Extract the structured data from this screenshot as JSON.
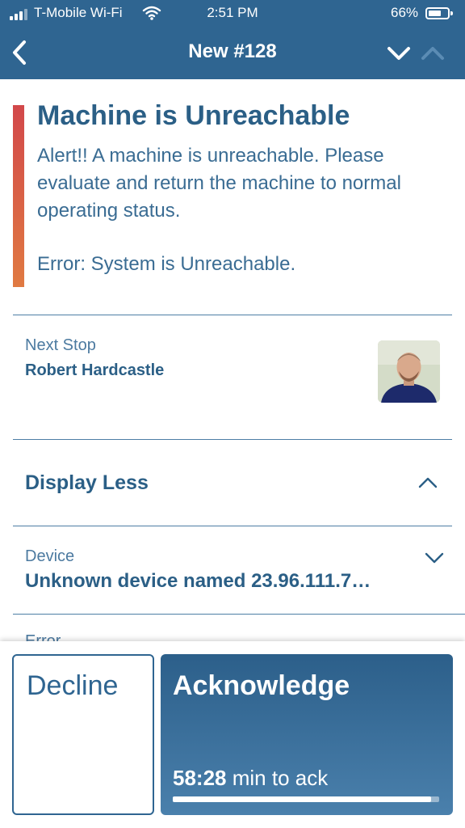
{
  "status_bar": {
    "carrier": "T-Mobile Wi-Fi",
    "time": "2:51 PM",
    "battery_percent": "66%",
    "battery_level": 0.66,
    "wifi_icon": "wifi-icon",
    "signal_icon": "signal-bars-icon"
  },
  "nav": {
    "title": "New #128",
    "back_icon": "chevron-left-icon",
    "next_icon": "chevron-down-icon",
    "prev_icon": "chevron-up-icon"
  },
  "alert": {
    "title": "Machine is Unreachable",
    "message": "Alert!!  A machine is unreachable. Please evaluate and return the machine to normal operating status.",
    "error": "Error: System is Unreachable.",
    "severity_color_top": "#d2484a",
    "severity_color_bottom": "#e07a42"
  },
  "next_stop": {
    "label": "Next Stop",
    "name": "Robert Hardcastle"
  },
  "details_toggle": {
    "label": "Display Less",
    "icon": "chevron-up-icon"
  },
  "device": {
    "label": "Device",
    "value": "Unknown device named 23.96.111.7…",
    "icon": "chevron-down-icon"
  },
  "next_field": {
    "label": "Error"
  },
  "actions": {
    "decline_label": "Decline",
    "acknowledge_label": "Acknowledge",
    "timer_value": "58:28",
    "timer_suffix": " min to ack",
    "timer_progress": 0.97
  },
  "colors": {
    "primary": "#2f6591",
    "text": "#2b5f86"
  }
}
